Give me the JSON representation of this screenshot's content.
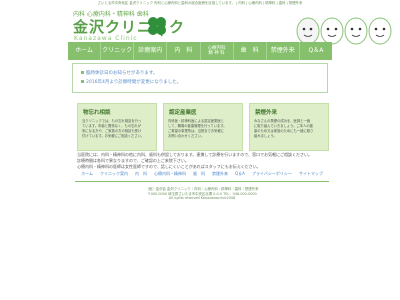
{
  "top_notice": "さいとる市中央地区 金沢クリニック 内科と心療内科と歯科の総合医療を目指しています。 | 内科 | 心療内科 | 精神科 | 歯科 | 禁煙外来",
  "header": {
    "subtitle": "内科 心療内科・精神科 歯科",
    "clinic_name": "金沢クリニック",
    "clinic_name_en": "Kanazawa Clinic"
  },
  "nav": [
    {
      "label": "ホーム"
    },
    {
      "label": "クリニック"
    },
    {
      "label": "診療案内"
    },
    {
      "label": "内　科"
    },
    {
      "label": "心療内科\n精 神 科"
    },
    {
      "label": "歯　科"
    },
    {
      "label": "禁煙外来"
    },
    {
      "label": "Q＆A"
    }
  ],
  "news": [
    {
      "text": "臨時休診日のお知らせがあります。"
    },
    {
      "text": "2016年4月より診察時間が変更になりました。"
    }
  ],
  "cards": [
    {
      "title": "物忘れ相談",
      "lines": [
        "当クリニックでは、もの忘れ相談を行っ",
        "ています。年齢と関係なく、もの忘れが",
        "気になる方や、ご家族の方の相談も受け",
        "付けています。お気軽にご相談ください。"
      ]
    },
    {
      "title": "認定産業医",
      "lines": [
        "内科医・精神科医による認定産業医と",
        "して、職場の健康管理を行っています。",
        "ご希望の事業所は、当院までお気軽に",
        "お問い合わせください。"
      ]
    },
    {
      "title": "禁煙外来",
      "lines": [
        "みなさんの禁煙の成功を、医師と一緒",
        "に取り組んでいきましょう。ご本人の健",
        "康のため又は家族のためにも一緒に取り",
        "組みましょう。"
      ]
    }
  ],
  "body_text": [
    "当医院には、内科・精神科の他に内科、歯科も併設しております。連携して診療を行いますので、窓口でお気軽にご相談ください。",
    "診療時間は各科で異なりますので、ご確認の上ご来院下さい。",
    "心療内科・精神科の医師は女性医師ですので、話しにくいことがあればスタッフにもお伝えください。"
  ],
  "footer_nav": [
    {
      "label": "ホーム"
    },
    {
      "label": "クリニック案内"
    },
    {
      "label": "内　科"
    },
    {
      "label": "心療内科・精神科"
    },
    {
      "label": "歯　科"
    },
    {
      "label": "禁煙外来"
    },
    {
      "label": "Q＆A"
    },
    {
      "label": "プライバシーポリシー"
    },
    {
      "label": "サイトマップ"
    }
  ],
  "footer_info": [
    "（医）金沢会 金沢クリニック｜内科｜心療内科・精神科｜歯科｜禁煙外来",
    "〒000-0000 埼玉県さいたま市中央区北郷 0-0-0 TEL：048-000-0000",
    "All rights reserved Kanazawaclinic2008"
  ],
  "colors": {
    "accent": "#86c06c",
    "brand": "#5aa04a",
    "link": "#4a86c7"
  }
}
